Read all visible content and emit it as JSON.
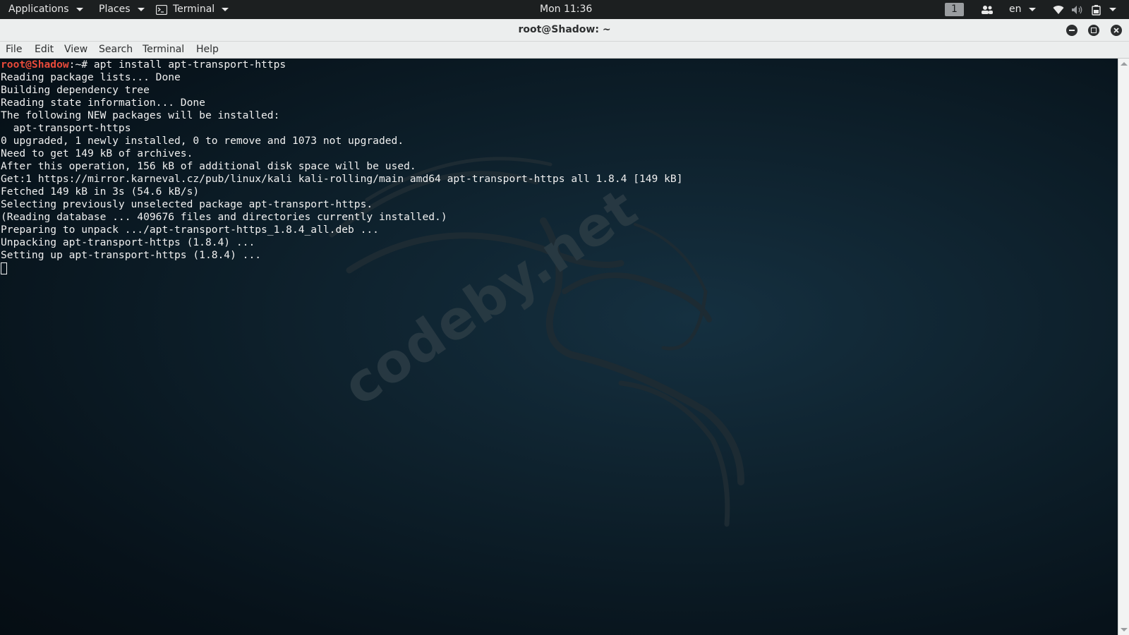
{
  "topbar": {
    "applications": "Applications",
    "places": "Places",
    "terminal_app": "Terminal",
    "clock": "Mon 11:36",
    "workspace": "1",
    "language": "en"
  },
  "window": {
    "title": "root@Shadow: ~"
  },
  "menubar": {
    "items": [
      "File",
      "Edit",
      "View",
      "Search",
      "Terminal",
      "Help"
    ]
  },
  "terminal": {
    "prompt_user": "root@Shadow",
    "prompt_rest": ":~# ",
    "command": "apt install apt-transport-https",
    "output": [
      "Reading package lists... Done",
      "Building dependency tree",
      "Reading state information... Done",
      "The following NEW packages will be installed:",
      "  apt-transport-https",
      "0 upgraded, 1 newly installed, 0 to remove and 1073 not upgraded.",
      "Need to get 149 kB of archives.",
      "After this operation, 156 kB of additional disk space will be used.",
      "Get:1 https://mirror.karneval.cz/pub/linux/kali kali-rolling/main amd64 apt-transport-https all 1.8.4 [149 kB]",
      "Fetched 149 kB in 3s (54.6 kB/s)",
      "Selecting previously unselected package apt-transport-https.",
      "(Reading database ... 409676 files and directories currently installed.)",
      "Preparing to unpack .../apt-transport-https_1.8.4_all.deb ...",
      "Unpacking apt-transport-https (1.8.4) ...",
      "Setting up apt-transport-https (1.8.4) ..."
    ]
  },
  "watermark": "codeby.net",
  "icons": {
    "terminal_app": "terminal-icon",
    "people": "people-icon",
    "wifi": "wifi-icon",
    "volume": "volume-icon",
    "battery": "battery-icon",
    "minimize": "minimize-icon",
    "maximize": "maximize-icon",
    "close": "close-icon"
  }
}
